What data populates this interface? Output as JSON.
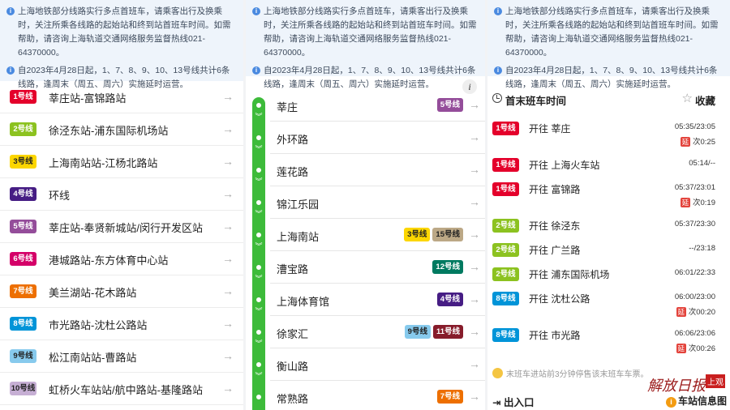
{
  "notice": {
    "line1": "上海地铁部分线路实行多点首班车，请乘客出行及换乘时，关注所乘各线路的起始站和终到站首班车时间。如需帮助，请咨询上海轨道交通网络服务监督热线021-64370000。",
    "line2": "自2023年4月28日起，1、7、8、9、10、13号线共计6条线路，逢周末（周五、周六）实施延时运营。"
  },
  "lines": [
    {
      "badge": "1号线",
      "route": "莘庄站-富锦路站",
      "color": "#e4002b"
    },
    {
      "badge": "2号线",
      "route": "徐泾东站-浦东国际机场站",
      "color": "#8cc220"
    },
    {
      "badge": "3号线",
      "route": "上海南站站-江杨北路站",
      "color": "#fcd600"
    },
    {
      "badge": "4号线",
      "route": "环线",
      "color": "#461d84"
    },
    {
      "badge": "5号线",
      "route": "莘庄站-奉贤新城站/闵行开发区站",
      "color": "#944d9a"
    },
    {
      "badge": "6号线",
      "route": "港城路站-东方体育中心站",
      "color": "#d40068"
    },
    {
      "badge": "7号线",
      "route": "美兰湖站-花木路站",
      "color": "#ed6f00"
    },
    {
      "badge": "8号线",
      "route": "市光路站-沈杜公路站",
      "color": "#0094d8"
    },
    {
      "badge": "9号线",
      "route": "松江南站站-曹路站",
      "color": "#87caed"
    },
    {
      "badge": "10号线",
      "route": "虹桥火车站站/航中路站-基隆路站",
      "color": "#c6afd4"
    }
  ],
  "stations": [
    {
      "name": "莘庄",
      "tags": [
        {
          "t": "5号线",
          "c": "#944d9a"
        }
      ]
    },
    {
      "name": "外环路",
      "tags": []
    },
    {
      "name": "莲花路",
      "tags": []
    },
    {
      "name": "锦江乐园",
      "tags": []
    },
    {
      "name": "上海南站",
      "tags": [
        {
          "t": "3号线",
          "c": "#fcd600"
        },
        {
          "t": "15号线",
          "c": "#bca886"
        }
      ]
    },
    {
      "name": "漕宝路",
      "tags": [
        {
          "t": "12号线",
          "c": "#007a60"
        }
      ]
    },
    {
      "name": "上海体育馆",
      "tags": [
        {
          "t": "4号线",
          "c": "#461d84"
        }
      ]
    },
    {
      "name": "徐家汇",
      "tags": [
        {
          "t": "9号线",
          "c": "#87caed"
        },
        {
          "t": "11号线",
          "c": "#871c2b"
        }
      ]
    },
    {
      "name": "衡山路",
      "tags": []
    },
    {
      "name": "常熟路",
      "tags": [
        {
          "t": "7号线",
          "c": "#ed6f00"
        }
      ]
    }
  ],
  "timetable": {
    "title": "首末班车时间",
    "favorite": "收藏",
    "rows": [
      {
        "badge": "1号线",
        "color": "#e4002b",
        "dest": "开往  莘庄",
        "times": "05:35/23:05",
        "delay": "次0:25"
      },
      {
        "badge": "1号线",
        "color": "#e4002b",
        "dest": "开往  上海火车站",
        "times": "05:14/--",
        "delay": ""
      },
      {
        "badge": "1号线",
        "color": "#e4002b",
        "dest": "开往  富锦路",
        "times": "05:37/23:01",
        "delay": "次0:19"
      },
      {
        "badge": "2号线",
        "color": "#8cc220",
        "dest": "开往  徐泾东",
        "times": "05:37/23:30",
        "delay": ""
      },
      {
        "badge": "2号线",
        "color": "#8cc220",
        "dest": "开往  广兰路",
        "times": "--/23:18",
        "delay": ""
      },
      {
        "badge": "2号线",
        "color": "#8cc220",
        "dest": "开往  浦东国际机场",
        "times": "06:01/22:33",
        "delay": ""
      },
      {
        "badge": "8号线",
        "color": "#0094d8",
        "dest": "开往  沈杜公路",
        "times": "06:00/23:00",
        "delay": "次00:20"
      },
      {
        "badge": "8号线",
        "color": "#0094d8",
        "dest": "开往  市光路",
        "times": "06:06/23:06",
        "delay": "次00:26"
      }
    ],
    "delay_tag": "延",
    "tip": "末班车进站前3分钟停售该末班车车票。",
    "exit_label": "出入口",
    "station_info": "车站信息图"
  },
  "logo": {
    "text": "解放日报",
    "mark": "上观"
  }
}
